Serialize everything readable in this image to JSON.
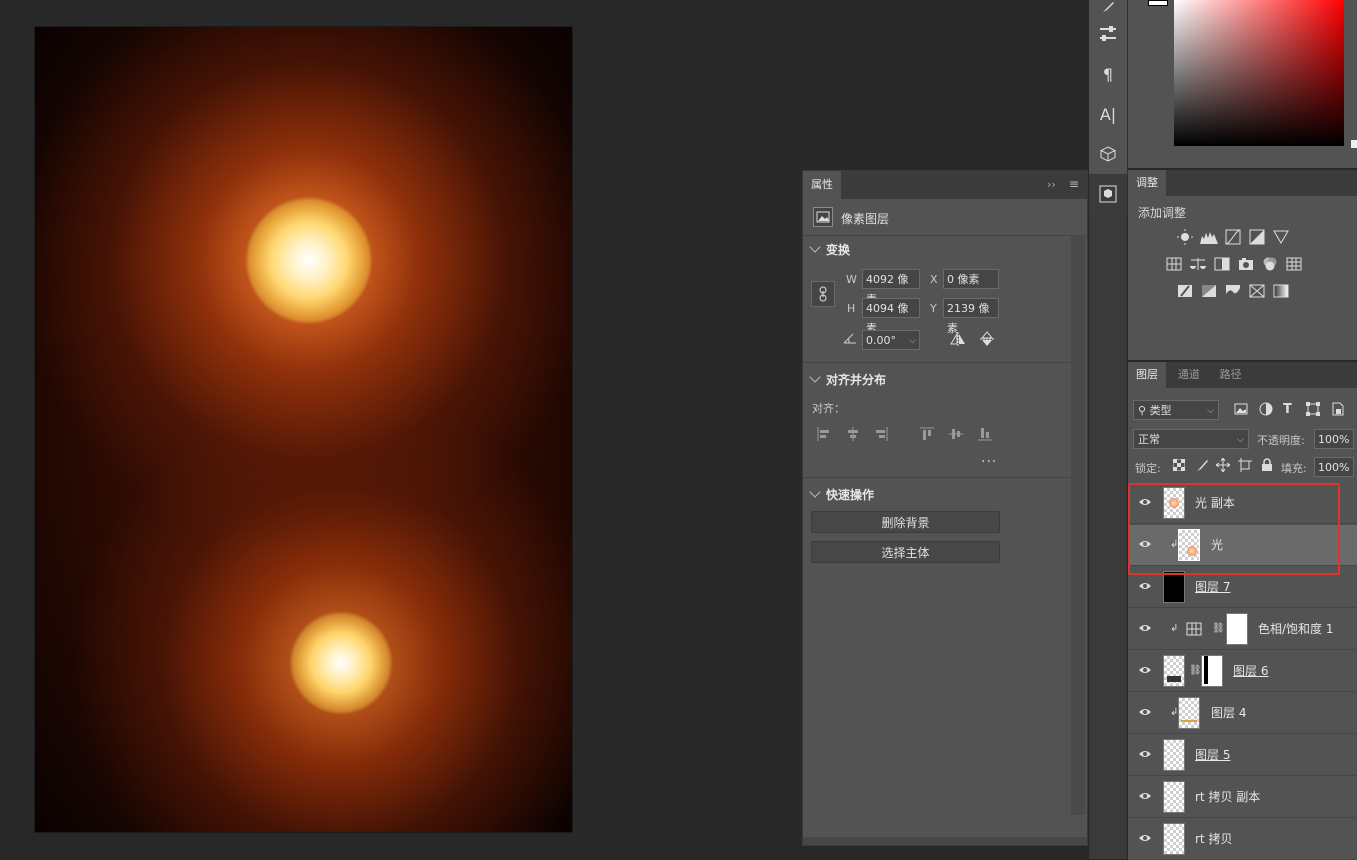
{
  "properties_panel": {
    "tab_label": "属性",
    "layer_kind": "像素图层",
    "transform": {
      "title": "变换",
      "w_label": "W",
      "w_value": "4092 像素",
      "x_label": "X",
      "x_value": "0 像素",
      "h_label": "H",
      "h_value": "4094 像素",
      "y_label": "Y",
      "y_value": "2139 像素",
      "angle_value": "0.00°"
    },
    "align": {
      "title": "对齐并分布",
      "label": "对齐："
    },
    "quick_actions": {
      "title": "快速操作",
      "remove_bg": "删除背景",
      "select_subject": "选择主体"
    }
  },
  "adjustments_panel": {
    "tab_label": "调整",
    "add_label": "添加调整"
  },
  "layers_panel": {
    "tabs": [
      "图层",
      "通道",
      "路径"
    ],
    "filter_value": "类型",
    "blend_mode": "正常",
    "opacity_label": "不透明度:",
    "opacity_value": "100%",
    "lock_label": "锁定:",
    "fill_label": "填充:",
    "fill_value": "100%",
    "layers": [
      {
        "name": "光 副本"
      },
      {
        "name": "光"
      },
      {
        "name": "图层 7"
      },
      {
        "name": "色相/饱和度 1"
      },
      {
        "name": "图层 6"
      },
      {
        "name": "图层 4"
      },
      {
        "name": "图层 5"
      },
      {
        "name": "rt 拷贝 副本"
      },
      {
        "name": "rt 拷贝"
      }
    ]
  },
  "colors": {
    "accent_highlight": "#e0322e",
    "panel_bg": "#535353",
    "app_bg": "#282828"
  },
  "icons": [
    "brush-icon",
    "sliders-icon",
    "paragraph-icon",
    "character-icon",
    "cube-icon",
    "3d-material-icon",
    "eye-icon",
    "link-icon"
  ]
}
